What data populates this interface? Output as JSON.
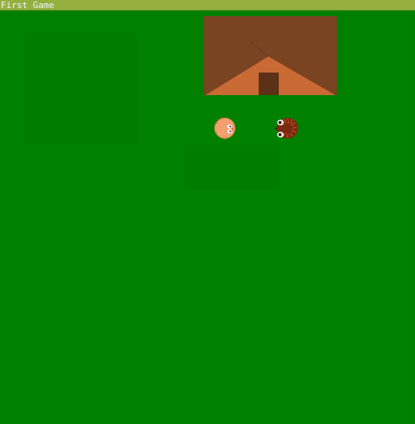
{
  "window": {
    "title": "First Game"
  },
  "colors": {
    "grass": "#008000",
    "titlebar": "#96b040",
    "title_text": "#e8f8ff",
    "house_wall": "#7a4321",
    "house_roof": "#c96a35",
    "house_door": "#5c3117",
    "player_skin": "#f2a070",
    "enemy_fur": "#7a2a10"
  },
  "scene": {
    "objects": [
      {
        "kind": "house",
        "icon": "house-icon"
      },
      {
        "kind": "player",
        "icon": "pink-creature-icon"
      },
      {
        "kind": "enemy",
        "icon": "brown-hedgehog-icon"
      }
    ]
  }
}
